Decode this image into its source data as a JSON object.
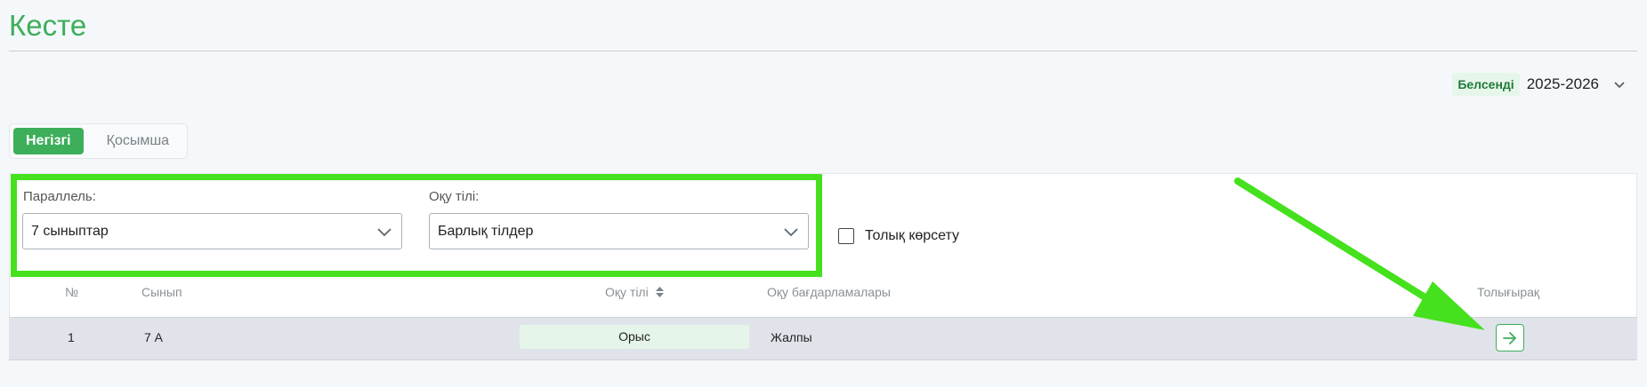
{
  "page": {
    "title": "Кесте"
  },
  "year": {
    "status_badge": "Белсенді",
    "value": "2025-2026"
  },
  "tabs": [
    {
      "label": "Негізгі",
      "active": true
    },
    {
      "label": "Қосымша",
      "active": false
    }
  ],
  "filters": {
    "parallel": {
      "label": "Параллель:",
      "value": "7 сыныптар"
    },
    "language": {
      "label": "Оқу тілі:",
      "value": "Барлық тілдер"
    },
    "show_full": {
      "label": "Толық көрсету",
      "checked": false
    }
  },
  "table": {
    "headers": {
      "number": "№",
      "class": "Сынып",
      "language": "Оқу тілі",
      "programs": "Оқу бағдарламалары",
      "more": "Толығырақ"
    },
    "rows": [
      {
        "number": "1",
        "class": "7 А",
        "language": "Орыс",
        "program": "Жалпы"
      }
    ]
  },
  "colors": {
    "brand_green": "#3dae5a",
    "highlight_annotation": "#45e11e"
  },
  "icons": {
    "year_dropdown": "chevron-down-icon",
    "select_dropdown": "chevron-down-icon",
    "sort": "sort-icon",
    "details": "arrow-right-icon"
  }
}
